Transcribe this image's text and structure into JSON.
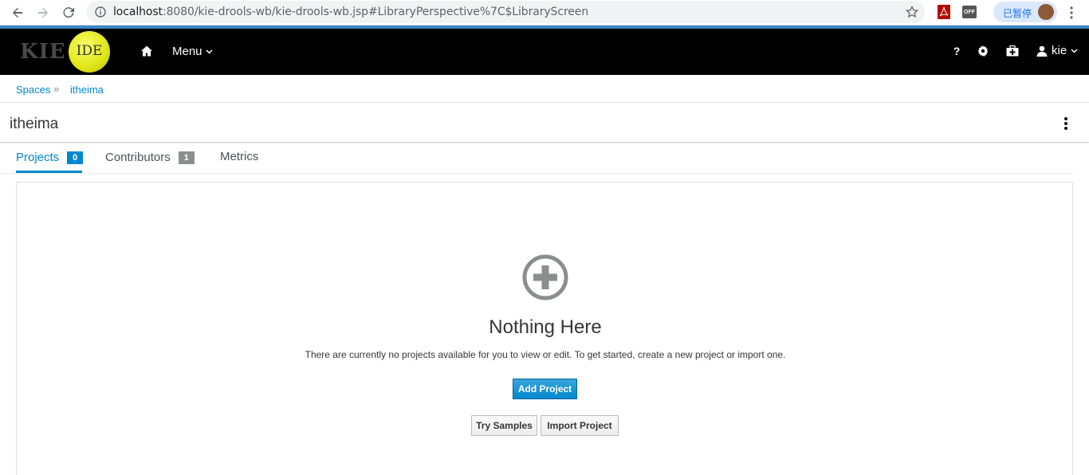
{
  "browser": {
    "url_host": "localhost",
    "url_rest": ":8080/kie-drools-wb/kie-drools-wb.jsp#LibraryPerspective%7C$LibraryScreen",
    "paused_label": "已暂停",
    "ext_off_label": "OFF"
  },
  "header": {
    "logo_text": "KIE",
    "logo_badge": "IDE",
    "menu_label": "Menu",
    "user_label": "kie",
    "help_label": "?"
  },
  "breadcrumb": {
    "items": [
      "Spaces",
      "itheima"
    ],
    "separator": "»"
  },
  "page": {
    "title": "itheima"
  },
  "tabs": [
    {
      "label": "Projects",
      "count": "0",
      "active": true
    },
    {
      "label": "Contributors",
      "count": "1",
      "active": false
    },
    {
      "label": "Metrics",
      "active": false
    }
  ],
  "empty_state": {
    "title": "Nothing Here",
    "text": "There are currently no projects available for you to view or edit. To get started, create a new project or import one.",
    "primary_button": "Add Project",
    "secondary_buttons": [
      "Try Samples",
      "Import Project"
    ]
  },
  "colors": {
    "accent": "#0088ce",
    "header_bg": "#000000",
    "logo_ball": "#e6ec1c"
  }
}
